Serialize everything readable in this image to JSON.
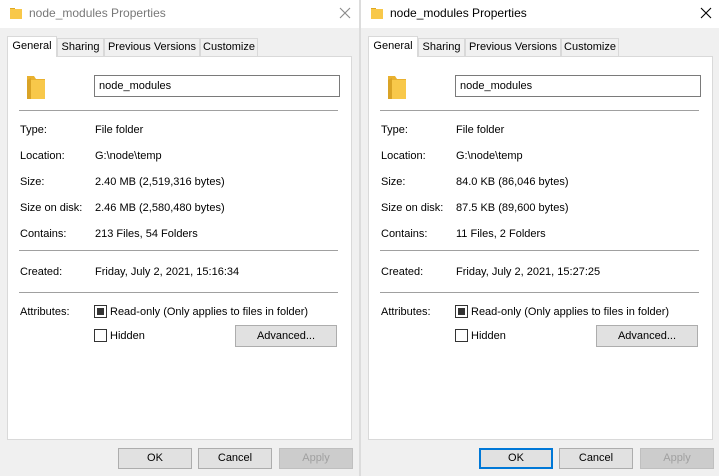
{
  "left": {
    "title": "node_modules Properties",
    "tabs": [
      "General",
      "Sharing",
      "Previous Versions",
      "Customize"
    ],
    "name": "node_modules",
    "type_label": "Type:",
    "type_value": "File folder",
    "location_label": "Location:",
    "location_value": "G:\\node\\temp",
    "size_label": "Size:",
    "size_value": "2.40 MB (2,519,316 bytes)",
    "size_on_disk_label": "Size on disk:",
    "size_on_disk_value": "2.46 MB (2,580,480 bytes)",
    "contains_label": "Contains:",
    "contains_value": "213 Files, 54 Folders",
    "created_label": "Created:",
    "created_value": "Friday, July 2, 2021, 15:16:34",
    "attributes_label": "Attributes:",
    "readonly_label": "Read-only (Only applies to files in folder)",
    "hidden_label": "Hidden",
    "advanced_label": "Advanced...",
    "ok_label": "OK",
    "cancel_label": "Cancel",
    "apply_label": "Apply"
  },
  "right": {
    "title": "node_modules Properties",
    "tabs": [
      "General",
      "Sharing",
      "Previous Versions",
      "Customize"
    ],
    "name": "node_modules",
    "type_label": "Type:",
    "type_value": "File folder",
    "location_label": "Location:",
    "location_value": "G:\\node\\temp",
    "size_label": "Size:",
    "size_value": "84.0 KB (86,046 bytes)",
    "size_on_disk_label": "Size on disk:",
    "size_on_disk_value": "87.5 KB (89,600 bytes)",
    "contains_label": "Contains:",
    "contains_value": "11 Files, 2 Folders",
    "created_label": "Created:",
    "created_value": "Friday, July 2, 2021, 15:27:25",
    "attributes_label": "Attributes:",
    "readonly_label": "Read-only (Only applies to files in folder)",
    "hidden_label": "Hidden",
    "advanced_label": "Advanced...",
    "ok_label": "OK",
    "cancel_label": "Cancel",
    "apply_label": "Apply"
  },
  "colors": {
    "folder": "#f8c84a",
    "accent": "#0078d7",
    "panel": "#ffffff",
    "chrome": "#f0f0f0"
  },
  "icons": {
    "folder": "folder-icon",
    "close": "close-icon"
  }
}
